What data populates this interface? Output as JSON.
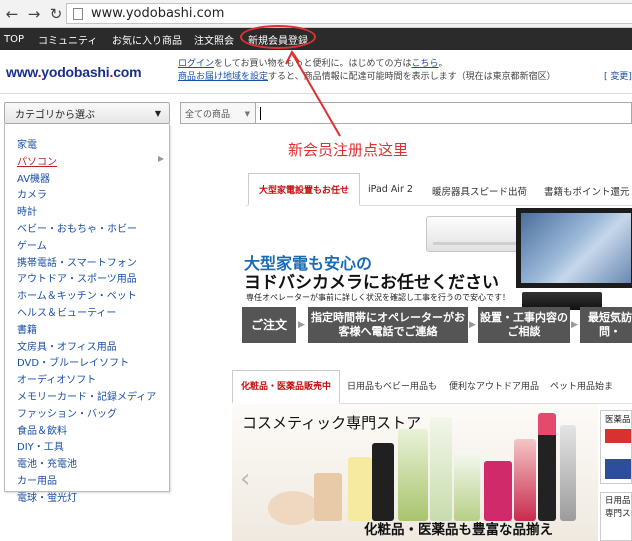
{
  "browser": {
    "url": "www.yodobashi.com"
  },
  "topnav": {
    "items": [
      "TOP",
      "コミュニティ",
      "お気に入り商品",
      "注文照会",
      "新規会員登録"
    ]
  },
  "header": {
    "logo": "www.yodobashi.com",
    "line1_link": "ログイン",
    "line1_text": "をしてお買い物をもっと便利に。はじめての方は",
    "line1_link2": "こちら",
    "line1_end": "。",
    "line2_link": "商品お届け地域を設定",
    "line2_text": "すると、商品情報に配達可能時間を表示します（現在は東京都新宿区）",
    "line2_change": "[ 変更]"
  },
  "search": {
    "category_button": "カテゴリから選ぶ",
    "scope": "全ての商品",
    "query": ""
  },
  "categories": [
    "家電",
    "パソコン",
    "AV機器",
    "カメラ",
    "時計",
    "ベビー・おもちゃ・ホビー",
    "ゲーム",
    "携帯電話・スマートフォン",
    "アウトドア・スポーツ用品",
    "ホーム＆キッチン・ペット",
    "ヘルス＆ビューティー",
    "書籍",
    "文房具・オフィス用品",
    "DVD・ブルーレイソフト",
    "オーディオソフト",
    "メモリーカード・記録メディア",
    "ファッション・バッグ",
    "食品＆飲料",
    "DIY・工具",
    "電池・充電池",
    "カー用品",
    "電球・蛍光灯"
  ],
  "annotation": {
    "text": "新会员注册点这里",
    "color": "#e03030"
  },
  "promo_tabs": [
    "大型家電設置もお任せ",
    "iPad Air 2",
    "暖房器具スピード出荷",
    "書籍もポイント還元"
  ],
  "banner1": {
    "title1": "大型家電も安心の",
    "title2": "ヨドバシカメラにお任せください",
    "subtitle": "専任オペレーターが事前に詳しく状況を確認し工事を行うので安心です！",
    "boxes": [
      "ご注文",
      "指定時間帯にオペレーターがお客様へ電話でご連絡",
      "設置・工事内容のご相談",
      "最短気訪問・"
    ]
  },
  "category_tabs": [
    "化粧品・医薬品販売中",
    "日用品もベビー用品も",
    "便利なアウトドア用品",
    "ペット用品始ま"
  ],
  "banner2": {
    "title": "コスメティック専門ストア",
    "subtitle": "化粧品・医薬品も豊富な品揃え"
  },
  "side": {
    "box1": "医薬品",
    "box2_line1": "日用品",
    "box2_line2": "専門ス"
  },
  "colors": {
    "nav_bg": "#2b2b2b",
    "logo": "#1a2e8f",
    "link": "#1a4fa8",
    "accent_red": "#c01010",
    "banner_blue": "#1a6db5"
  }
}
